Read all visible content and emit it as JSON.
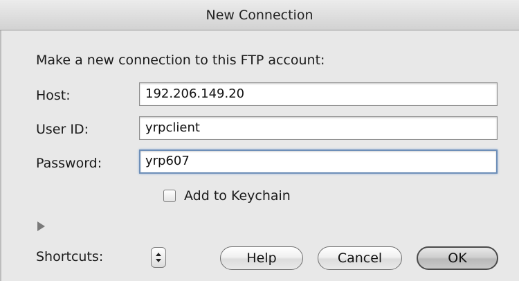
{
  "window": {
    "title": "New Connection"
  },
  "form": {
    "heading": "Make a new connection to this FTP account:",
    "host": {
      "label": "Host:",
      "value": "192.206.149.20"
    },
    "user_id": {
      "label": "User ID:",
      "value": "yrpclient"
    },
    "password": {
      "label": "Password:",
      "value": "yrp607"
    },
    "keychain": {
      "label": "Add to Keychain",
      "checked": false
    }
  },
  "footer": {
    "shortcuts_label": "Shortcuts:",
    "help_label": "Help",
    "cancel_label": "Cancel",
    "ok_label": "OK"
  },
  "colors": {
    "focus_ring": "#6e8fb8",
    "dialog_bg": "#e8e8e8"
  }
}
